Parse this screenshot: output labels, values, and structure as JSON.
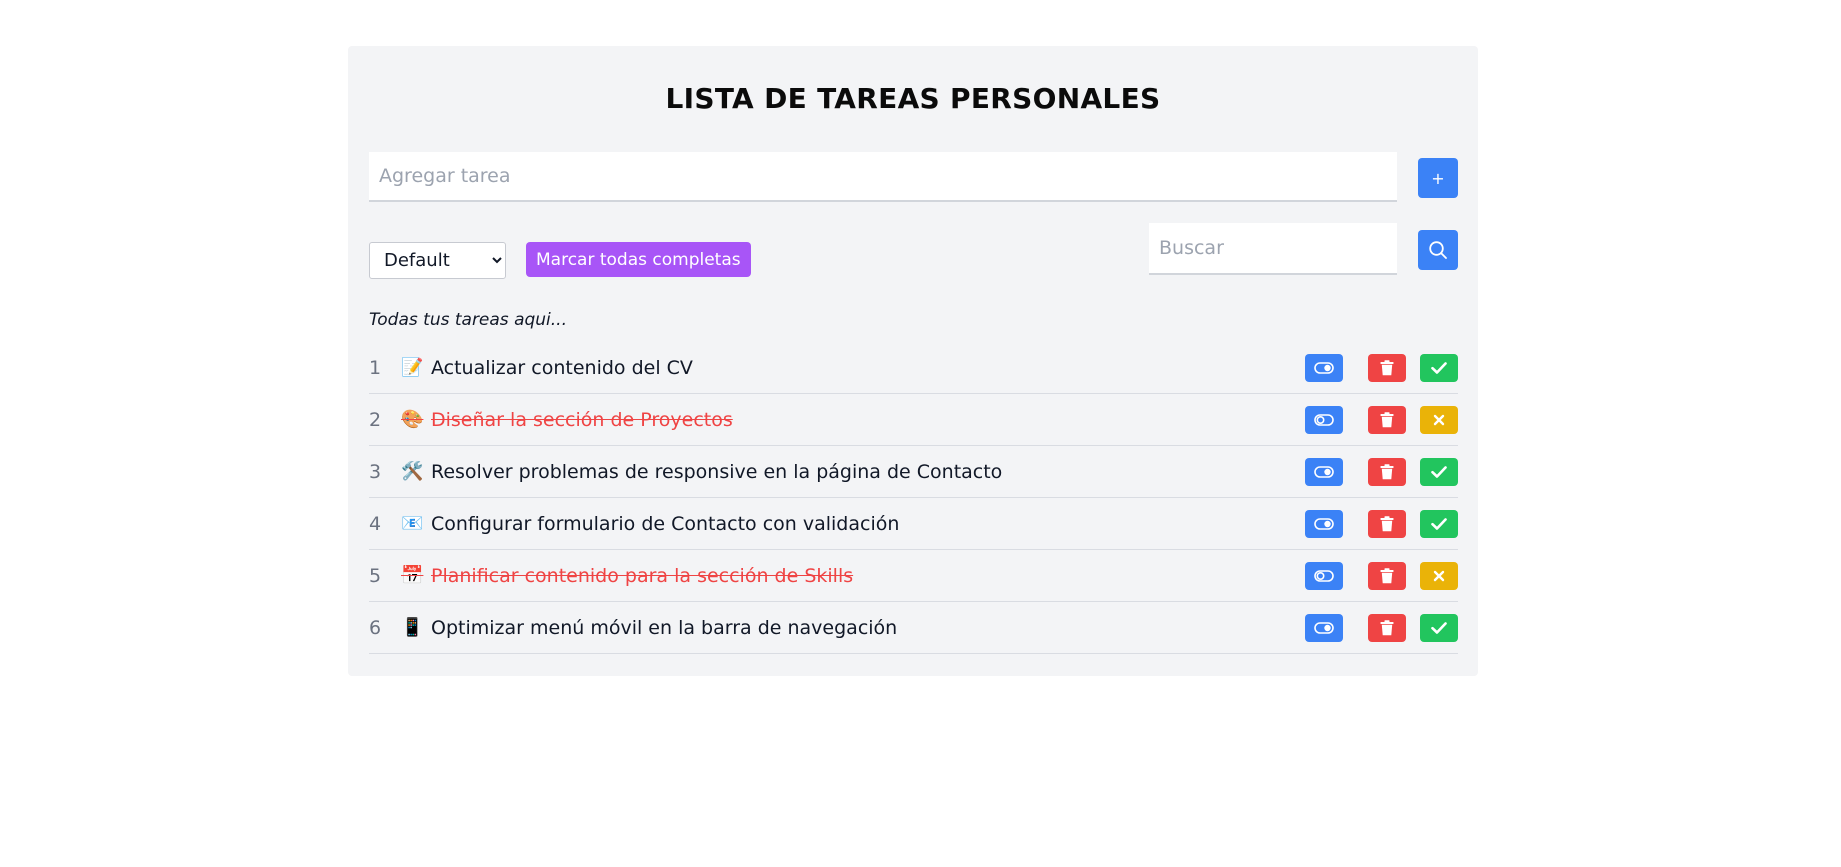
{
  "header": {
    "title": "LISTA DE TAREAS PERSONALES"
  },
  "add": {
    "placeholder": "Agregar tarea",
    "button_label": "+"
  },
  "controls": {
    "sort_selected": "Default",
    "mark_all_label": "Marcar todas completas",
    "search_placeholder": "Buscar"
  },
  "list": {
    "subtitle": "Todas tus tareas aqui...",
    "tasks": [
      {
        "num": "1",
        "emoji": "📝",
        "text": "Actualizar contenido del CV",
        "completed": false
      },
      {
        "num": "2",
        "emoji": "🎨",
        "text": "Diseñar la sección de Proyectos",
        "completed": true
      },
      {
        "num": "3",
        "emoji": "🛠️",
        "text": "Resolver problemas de responsive en la página de Contacto",
        "completed": false
      },
      {
        "num": "4",
        "emoji": "📧",
        "text": "Configurar formulario de Contacto con validación",
        "completed": false
      },
      {
        "num": "5",
        "emoji": "📅",
        "text": "Planificar contenido para la sección de Skills",
        "completed": true
      },
      {
        "num": "6",
        "emoji": "📱",
        "text": "Optimizar menú móvil en la barra de navegación",
        "completed": false
      }
    ]
  },
  "colors": {
    "primary": "#3b82f6",
    "danger": "#ef4444",
    "success": "#22c55e",
    "warning": "#eab308",
    "purple": "#a855f7",
    "panel_bg": "#f3f4f6"
  }
}
